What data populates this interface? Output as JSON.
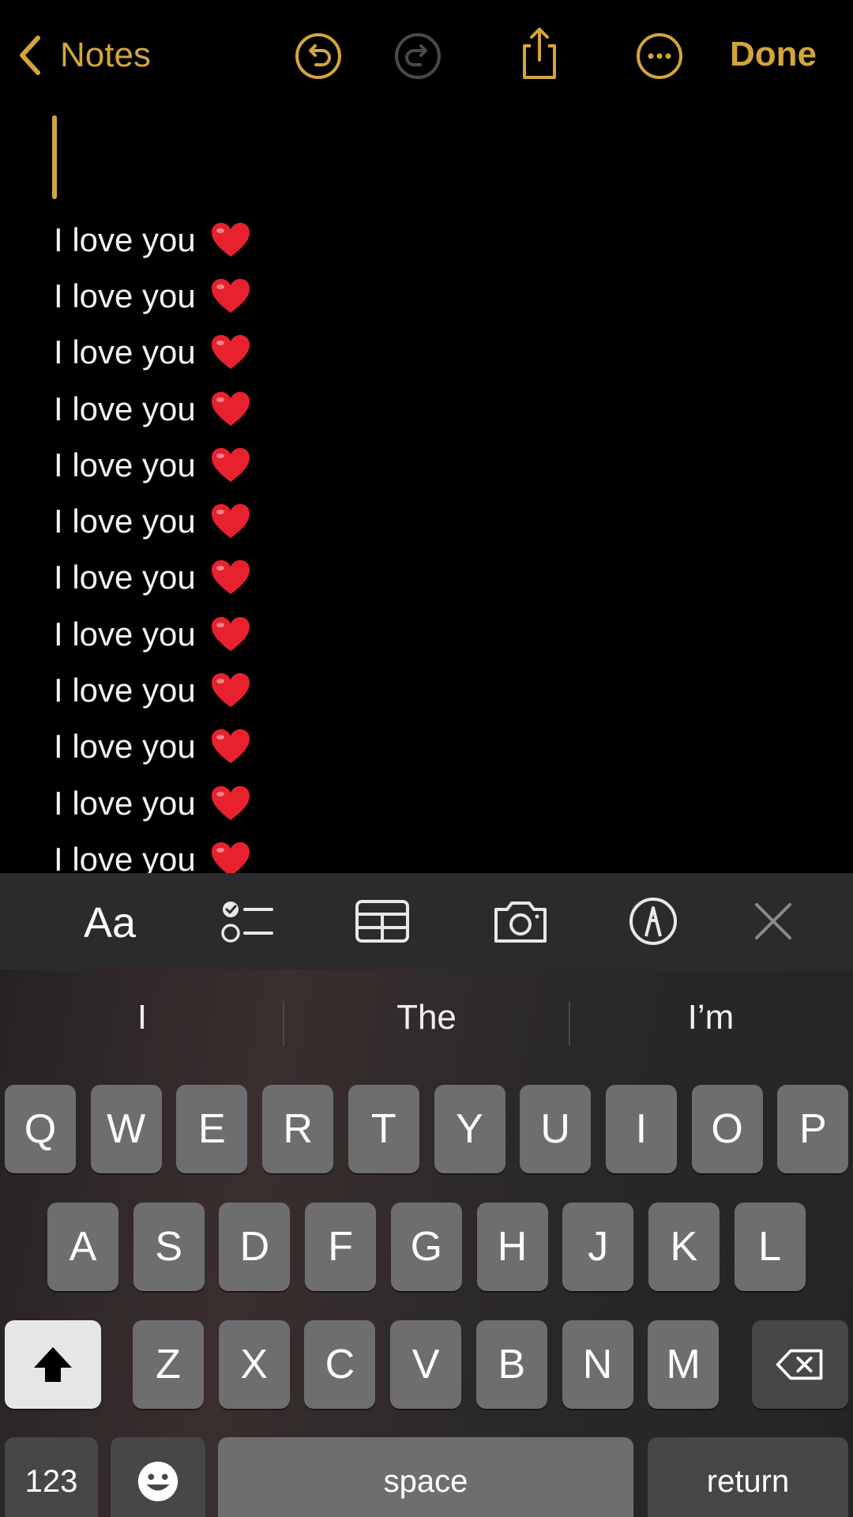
{
  "nav": {
    "back_label": "Notes",
    "done_label": "Done",
    "icons": [
      "undo-icon",
      "redo-icon",
      "share-icon",
      "more-icon"
    ]
  },
  "note": {
    "lines": [
      "I love you",
      "I love you",
      "I love you",
      "I love you",
      "I love you",
      "I love you",
      "I love you",
      "I love you",
      "I love you",
      "I love you",
      "I love you",
      "I love you"
    ],
    "line_emoji": "red-heart-icon"
  },
  "toolbar": {
    "format_label": "Aa",
    "icons": [
      "format-text-icon",
      "checklist-icon",
      "table-icon",
      "camera-icon",
      "markup-icon",
      "close-icon"
    ]
  },
  "keyboard": {
    "predictions": [
      "I",
      "The",
      "I’m"
    ],
    "row1": [
      "Q",
      "W",
      "E",
      "R",
      "T",
      "Y",
      "U",
      "I",
      "O",
      "P"
    ],
    "row2": [
      "A",
      "S",
      "D",
      "F",
      "G",
      "H",
      "J",
      "K",
      "L"
    ],
    "row3": [
      "Z",
      "X",
      "C",
      "V",
      "B",
      "N",
      "M"
    ],
    "numbers_label": "123",
    "space_label": "space",
    "return_label": "return"
  },
  "colors": {
    "accent": "#d4a53a",
    "background": "#000000",
    "key": "#6e6e70",
    "key_dark": "#474749",
    "heart": "#e8212f"
  }
}
